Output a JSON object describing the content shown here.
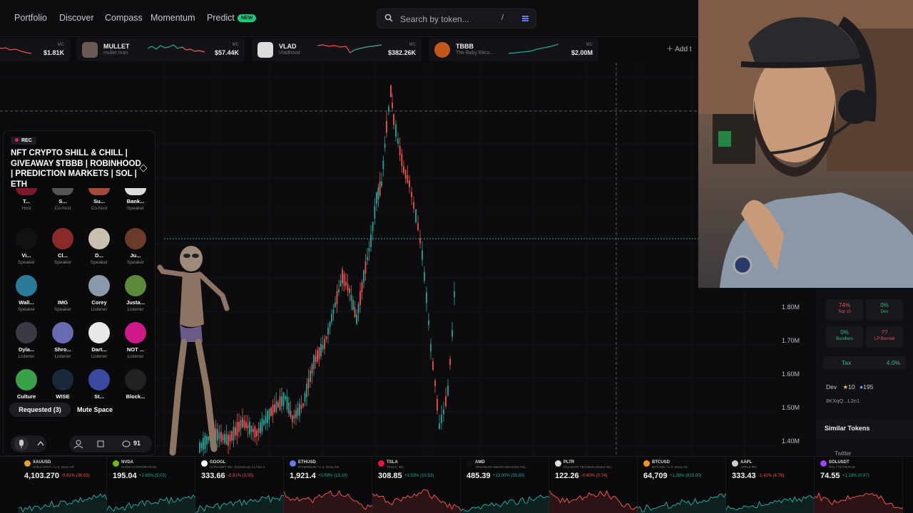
{
  "nav": {
    "items": [
      "Portfolio",
      "Discover",
      "Compass",
      "Momentum",
      "Predict"
    ],
    "predict_badge": "NEW",
    "search_placeholder": "Search by token...",
    "search_shortcut": "/"
  },
  "watchlist": {
    "cards": [
      {
        "name": "",
        "sub": "",
        "mc": "MC",
        "price": "$1.81K",
        "trend": "down"
      },
      {
        "name": "MULLET",
        "sub": "mullet man",
        "mc": "MC",
        "price": "$57.44K",
        "trend": "down"
      },
      {
        "name": "VLAD",
        "sub": "Vladhood",
        "mc": "MC",
        "price": "$382.26K",
        "trend": "up"
      },
      {
        "name": "TBBB",
        "sub": "The Baby Bitco...",
        "mc": "MC",
        "price": "$2.00M",
        "trend": "up"
      }
    ],
    "add_label": "Add t"
  },
  "chart": {
    "y_ticks": [
      "1.80M",
      "1.70M",
      "1.60M",
      "1.50M",
      "1.40M"
    ],
    "up_color": "#26a69a",
    "down_color": "#ef5350"
  },
  "space": {
    "rec_label": "REC",
    "title": "NFT CRYPTO SHILL & CHILL | GIVEAWAY $TBBB | ROBINHOOD | PREDICTION MARKETS | SOL | ETH",
    "participants": [
      {
        "name": "T...",
        "role": "Host",
        "color": "#7a1a2a"
      },
      {
        "name": "S...",
        "role": "Co-host",
        "color": "#555"
      },
      {
        "name": "Su...",
        "role": "Co-host",
        "color": "#a04a3a"
      },
      {
        "name": "Bank...",
        "role": "Speaker",
        "color": "#ddd"
      },
      {
        "name": "Vi...",
        "role": "Speaker",
        "color": "#111"
      },
      {
        "name": "Cl...",
        "role": "Speaker",
        "color": "#8a2a2a"
      },
      {
        "name": "D...",
        "role": "Speaker",
        "color": "#c9c0b0"
      },
      {
        "name": "Ju...",
        "role": "Speaker",
        "color": "#6a3a2a"
      },
      {
        "name": "Wall...",
        "role": "Speaker",
        "color": "#2a7a9a"
      },
      {
        "name": "IMG",
        "role": "Speaker",
        "color": "#0a0a0c"
      },
      {
        "name": "Corey",
        "role": "Listener",
        "color": "#8a9aaa"
      },
      {
        "name": "Justa...",
        "role": "Listener",
        "color": "#5a8a3a"
      },
      {
        "name": "Dyla...",
        "role": "Listener",
        "color": "#3a3a44"
      },
      {
        "name": "Shro...",
        "role": "Listener",
        "color": "#6a6ab0"
      },
      {
        "name": "Dart...",
        "role": "Listener",
        "color": "#e8e8e8"
      },
      {
        "name": "NOT ...",
        "role": "Listener",
        "color": "#d01a8a"
      },
      {
        "name": "Culture",
        "role": "",
        "color": "#3aa04a"
      },
      {
        "name": "WISE",
        "role": "",
        "color": "#1a2a3a"
      },
      {
        "name": "St...",
        "role": "",
        "color": "#3a4aa0"
      },
      {
        "name": "Block...",
        "role": "",
        "color": "#222"
      }
    ],
    "requested_label": "Requested (3)",
    "mute_label": "Mute Space",
    "comment_count": "91",
    "img_placeholder": "[img]"
  },
  "right_panel": {
    "stats": [
      {
        "value": "74%",
        "label": "Top 10",
        "color": "#ef5350"
      },
      {
        "value": "0%",
        "label": "Dev",
        "color": "#26c281"
      },
      {
        "value": "0%",
        "label": "Bundlers",
        "color": "#26c281"
      },
      {
        "value": "??",
        "label": "LP Burned",
        "color": "#ef5350"
      }
    ],
    "tax_label": "Tax",
    "tax_value": "4.0%",
    "dev_label": "Dev",
    "dev_count_a": "10",
    "dev_count_b": "195",
    "address": "8KXqQ...L2n1",
    "similar_tokens": "Similar Tokens",
    "twitter": "Twitter"
  },
  "ticker": [
    {
      "sym": "XAUUSD",
      "sub": "GOLD SPOT / U.S. DOLLAR",
      "price": "4,103.270",
      "chg": "-0.91% (36.93)",
      "color": "#e2a42b",
      "dir": "up"
    },
    {
      "sym": "NVDA",
      "sub": "NVIDIA CORPORATION",
      "price": "195.04",
      "chg": "+2.65% (5.03)",
      "color": "#76b900",
      "dir": "up"
    },
    {
      "sym": "GOOGL",
      "sub": "ALPHABET INC. (GOOGLE) CLASS A",
      "price": "333.66",
      "chg": "-0.91% (3.05)",
      "color": "#ffffff",
      "dir": "up"
    },
    {
      "sym": "ETHUSD",
      "sub": "ETHEREUM / U.S. DOLLAR",
      "price": "1,921.4",
      "chg": "+0.69% (13.10)",
      "color": "#627eea",
      "dir": "down"
    },
    {
      "sym": "TSLA",
      "sub": "TESLA, INC.",
      "price": "308.85",
      "chg": "+3.53% (10.53)",
      "color": "#e31937",
      "dir": "down"
    },
    {
      "sym": "AMD",
      "sub": "ADVANCED MICRO DEVICES INC.",
      "price": "485.39",
      "chg": "+13.00% (55.83)",
      "color": "#111111",
      "dir": "up"
    },
    {
      "sym": "PLTR",
      "sub": "PALANTIR TECHNOLOGIES INC.",
      "price": "122.26",
      "chg": "-0.60% (0.74)",
      "color": "#dddddd",
      "dir": "down"
    },
    {
      "sym": "BTCUSD",
      "sub": "BITCOIN / U.S. DOLLAR",
      "price": "64,709",
      "chg": "+1.28% (815.00)",
      "color": "#f7931a",
      "dir": "up"
    },
    {
      "sym": "AAPL",
      "sub": "APPLE INC.",
      "price": "333.43",
      "chg": "-1.41% (4.76)",
      "color": "#cccccc",
      "dir": "up"
    },
    {
      "sym": "SOLUSDT",
      "sub": "SOL / TETHERUS",
      "price": "74.55",
      "chg": "+1.18% (0.87)",
      "color": "#9945ff",
      "dir": "down"
    }
  ]
}
